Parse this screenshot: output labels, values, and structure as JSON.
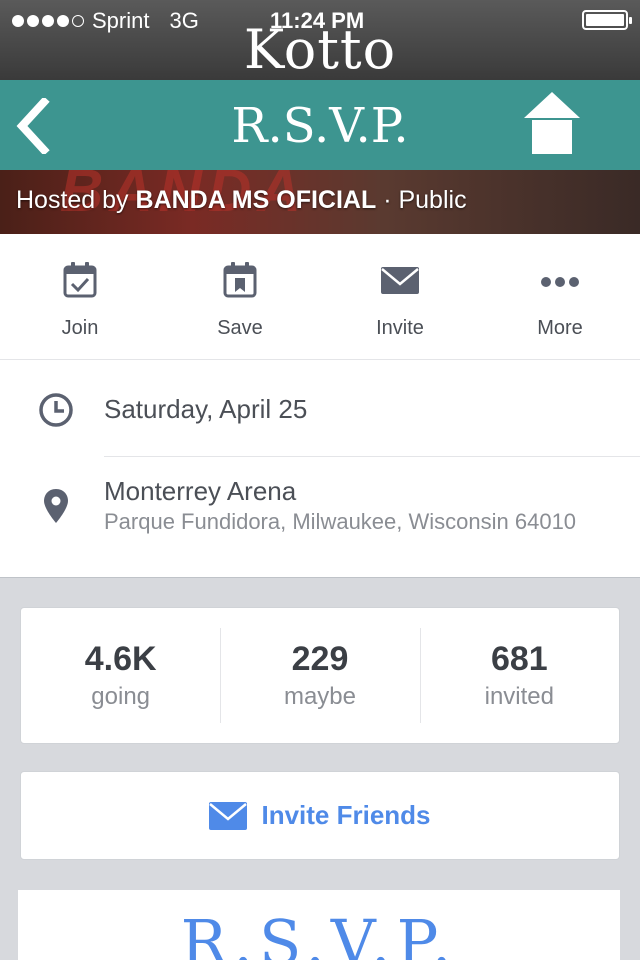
{
  "status_bar": {
    "carrier": "Sprint",
    "network": "3G",
    "time": "11:24 PM"
  },
  "app_title": "Kotto",
  "header": {
    "title": "R.S.V.P."
  },
  "banner": {
    "hosted_prefix": "Hosted by",
    "host": "BANDA MS  OFICIAL",
    "visibility": "· Public"
  },
  "actions": [
    {
      "label": "Join",
      "icon": "calendar-check-icon"
    },
    {
      "label": "Save",
      "icon": "calendar-bookmark-icon"
    },
    {
      "label": "Invite",
      "icon": "envelope-icon"
    },
    {
      "label": "More",
      "icon": "more-dots-icon"
    }
  ],
  "event": {
    "date": "Saturday, April 25",
    "place_name": "Monterrey Arena",
    "place_address": "Parque Fundidora, Milwaukee, Wisconsin 64010"
  },
  "stats": [
    {
      "value": "4.6K",
      "label": "going"
    },
    {
      "value": "229",
      "label": "maybe"
    },
    {
      "value": "681",
      "label": "invited"
    }
  ],
  "invite_button": "Invite Friends",
  "rsvp_card_title": "R.S.V.P.",
  "colors": {
    "header_teal": "#3d9590",
    "link_blue": "#4f8ae8",
    "icon_gray": "#5b6170"
  }
}
